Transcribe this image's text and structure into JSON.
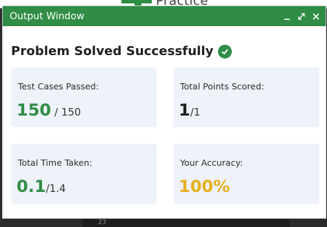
{
  "background": {
    "logo_text": "Practice",
    "line_number": "23"
  },
  "window": {
    "title": "Output Window",
    "controls": [
      "minimize-icon",
      "expand-icon",
      "close-icon"
    ]
  },
  "result": {
    "heading": "Problem Solved Successfully",
    "status_icon": "check-circle-icon",
    "accent_color": "#2f8d46"
  },
  "stats": {
    "test_cases": {
      "label": "Test Cases Passed:",
      "value": "150",
      "separator": " / ",
      "total": "150"
    },
    "points": {
      "label": "Total Points Scored:",
      "value": "1",
      "separator": "/",
      "total": "1"
    },
    "time": {
      "label": "Total Time Taken:",
      "value": "0.1",
      "separator": "/",
      "total": "1.4"
    },
    "accuracy": {
      "label": "Your Accuracy:",
      "value": "100%"
    }
  },
  "colors": {
    "success_green": "#2f8d46",
    "accuracy_gold": "#e6b01c",
    "card_bg": "#eef2f9"
  }
}
